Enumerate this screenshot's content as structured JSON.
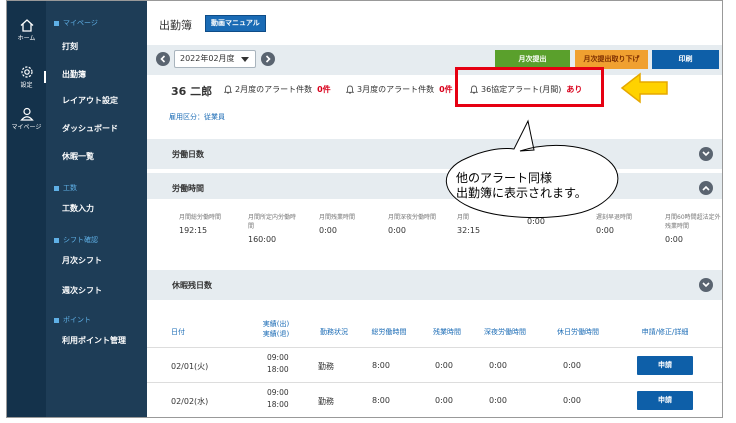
{
  "rail": [
    {
      "label": "ホーム",
      "icon": "home-icon"
    },
    {
      "label": "設定",
      "icon": "gear-icon"
    },
    {
      "label": "マイページ",
      "icon": "user-icon"
    }
  ],
  "nav": {
    "sections": [
      {
        "title": "マイページ",
        "items": [
          "打刻",
          "出勤簿",
          "レイアウト設定",
          "ダッシュボード",
          "休暇一覧"
        ]
      },
      {
        "title": "工数",
        "items": [
          "工数入力"
        ]
      },
      {
        "title": "シフト確認",
        "items": [
          "月次シフト",
          "週次シフト"
        ]
      },
      {
        "title": "ポイント",
        "items": [
          "利用ポイント管理"
        ]
      }
    ]
  },
  "header": {
    "title": "出勤簿",
    "manual_button": "動画マニュアル"
  },
  "toolbar": {
    "month": "2022年02月度",
    "submit_button": "月次提出",
    "withdraw_button": "月次提出取り下げ",
    "print_button": "印刷"
  },
  "employee": {
    "name": "36 二郎",
    "alerts": [
      {
        "label": "2月度のアラート件数",
        "value": "0件"
      },
      {
        "label": "3月度のアラート件数",
        "value": "0件"
      },
      {
        "label": "36協定アラート(月間)",
        "value": "あり"
      }
    ],
    "employment_type": "雇用区分：従業員"
  },
  "sections": {
    "work_days": "労働日数",
    "work_hours": "労働時間",
    "leave": "休暇残日数"
  },
  "work_hours": [
    {
      "label": "月間総労働時間",
      "value": "192:15"
    },
    {
      "label": "月間所定内労働時間",
      "value": "160:00"
    },
    {
      "label": "月間残業時間",
      "value": "0:00"
    },
    {
      "label": "月間深夜労働時間",
      "value": "0:00"
    },
    {
      "label": "月間",
      "value": "32:15"
    },
    {
      "label": "",
      "value": "0:00"
    },
    {
      "label": "遅刻早退時間",
      "value": "0:00"
    },
    {
      "label": "月間60時間超法定外残業時間",
      "value": "0:00"
    }
  ],
  "table": {
    "headers": [
      "日付",
      "実績(出)\n実績(退)",
      "勤務状況",
      "総労働時間",
      "残業時間",
      "深夜労働時間",
      "休日労働時間",
      "申請/修正/詳細"
    ],
    "rows": [
      {
        "date": "02/01(火)",
        "in": "09:00",
        "out": "18:00",
        "status": "勤務",
        "total": "8:00",
        "overtime": "0:00",
        "night": "0:00",
        "holiday": "0:00",
        "action": "申請"
      },
      {
        "date": "02/02(水)",
        "in": "09:00",
        "out": "18:00",
        "status": "勤務",
        "total": "8:00",
        "overtime": "0:00",
        "night": "0:00",
        "holiday": "0:00",
        "action": "申請"
      }
    ]
  },
  "callout": {
    "line1": "他のアラート同様",
    "line2": "出勤簿に表示されます。"
  },
  "colors": {
    "accent_red": "#e60012",
    "arrow_fill": "#ffd200",
    "submit_green": "#5aa02c",
    "withdraw_orange": "#f0a030",
    "primary_blue": "#0e5fa8"
  }
}
